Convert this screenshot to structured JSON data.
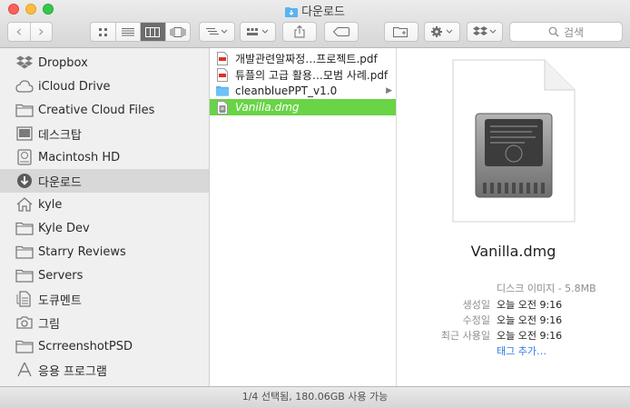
{
  "window": {
    "title": "다운로드"
  },
  "toolbar": {
    "back_label": "‹",
    "forward_label": "›",
    "view_modes": [
      "icons",
      "list",
      "columns",
      "cover-flow"
    ],
    "active_view": "columns",
    "search_placeholder": "검색"
  },
  "sidebar": {
    "items": [
      {
        "label": "Dropbox",
        "icon": "dropbox-icon"
      },
      {
        "label": "iCloud Drive",
        "icon": "cloud-icon"
      },
      {
        "label": "Creative Cloud Files",
        "icon": "folder-icon"
      },
      {
        "label": "데스크탑",
        "icon": "desktop-icon"
      },
      {
        "label": "Macintosh HD",
        "icon": "harddisk-icon"
      },
      {
        "label": "다운로드",
        "icon": "download-icon",
        "selected": true
      },
      {
        "label": "kyle",
        "icon": "home-icon"
      },
      {
        "label": "Kyle Dev",
        "icon": "folder-icon"
      },
      {
        "label": "Starry Reviews",
        "icon": "folder-icon"
      },
      {
        "label": "Servers",
        "icon": "folder-icon"
      },
      {
        "label": "도큐멘트",
        "icon": "document-icon"
      },
      {
        "label": "그림",
        "icon": "camera-icon"
      },
      {
        "label": "ScrreenshotPSD",
        "icon": "folder-icon"
      },
      {
        "label": "응용 프로그램",
        "icon": "applications-icon"
      }
    ]
  },
  "files": [
    {
      "name": "개발관련알짜정…프로젝트.pdf",
      "icon": "pdf-icon"
    },
    {
      "name": "튜플의 고급 활용…모범 사례.pdf",
      "icon": "pdf-icon"
    },
    {
      "name": "cleanbluePPT_v1.0",
      "icon": "folder-icon",
      "has_children": true
    },
    {
      "name": "Vanilla.dmg",
      "icon": "dmg-icon",
      "selected": true
    }
  ],
  "preview": {
    "name": "Vanilla.dmg",
    "kind": "디스크 이미지 - 5.8MB",
    "rows": [
      {
        "label": "생성일",
        "value": "오늘 오전 9:16"
      },
      {
        "label": "수정일",
        "value": "오늘 오전 9:16"
      },
      {
        "label": "최근 사용일",
        "value": "오늘 오전 9:16"
      }
    ],
    "tags_link": "태그 추가…"
  },
  "status": {
    "text": "1/4 선택됨, 180.06GB 사용 가능"
  },
  "colors": {
    "selection_green": "#69d446",
    "link_blue": "#2e7ae6",
    "folder_blue": "#5ab3f0"
  }
}
